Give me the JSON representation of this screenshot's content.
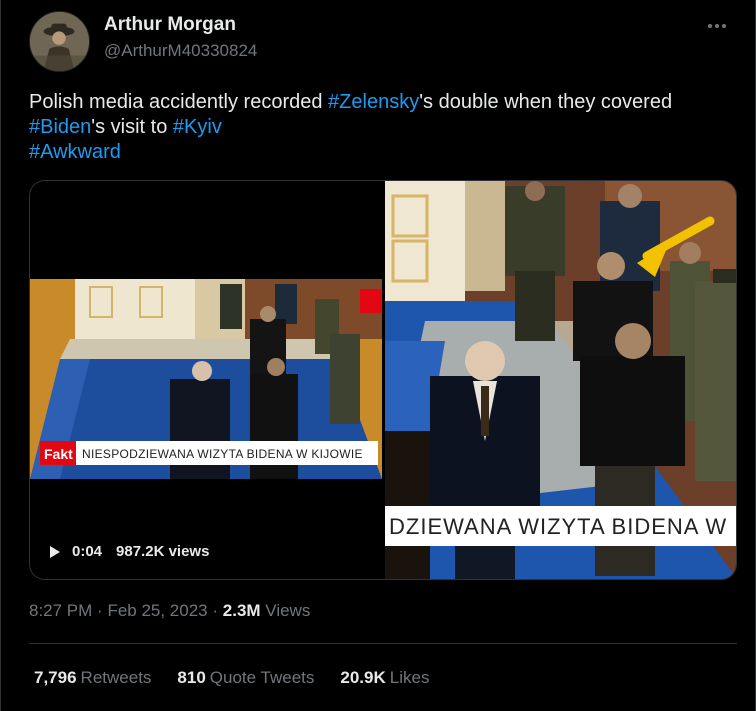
{
  "author": {
    "name": "Arthur Morgan",
    "handle": "@ArthurM40330824"
  },
  "tweet": {
    "segments": [
      {
        "text": "Polish media accidently recorded ",
        "tag": false
      },
      {
        "text": "#Zelensky",
        "tag": true
      },
      {
        "text": "'s double when they covered ",
        "tag": false
      },
      {
        "text": "#Biden",
        "tag": true
      },
      {
        "text": "'s visit to ",
        "tag": false
      },
      {
        "text": "#Kyiv",
        "tag": true
      },
      {
        "text": "#Awkward",
        "tag": true,
        "newline": true
      }
    ]
  },
  "media": {
    "video": {
      "duration": "0:04",
      "views": "987.2K views",
      "caption_banner": "NIESPODZIEWANA WIZYTA BIDENA W KIJOWIE",
      "logo": "Fakt"
    },
    "image": {
      "caption_banner": "DZIEWANA WIZYTA BIDENA W"
    }
  },
  "meta": {
    "time": "8:27 PM",
    "date": "Feb 25, 2023",
    "views_count": "2.3M",
    "views_label": "Views"
  },
  "stats": {
    "retweets_count": "7,796",
    "retweets_label": "Retweets",
    "quotes_count": "810",
    "quotes_label": "Quote Tweets",
    "likes_count": "20.9K",
    "likes_label": "Likes"
  },
  "colors": {
    "accent": "#1d9bf0",
    "secondary_text": "#71767b",
    "arrow": "#f2c200",
    "fakt_red": "#e30613"
  }
}
